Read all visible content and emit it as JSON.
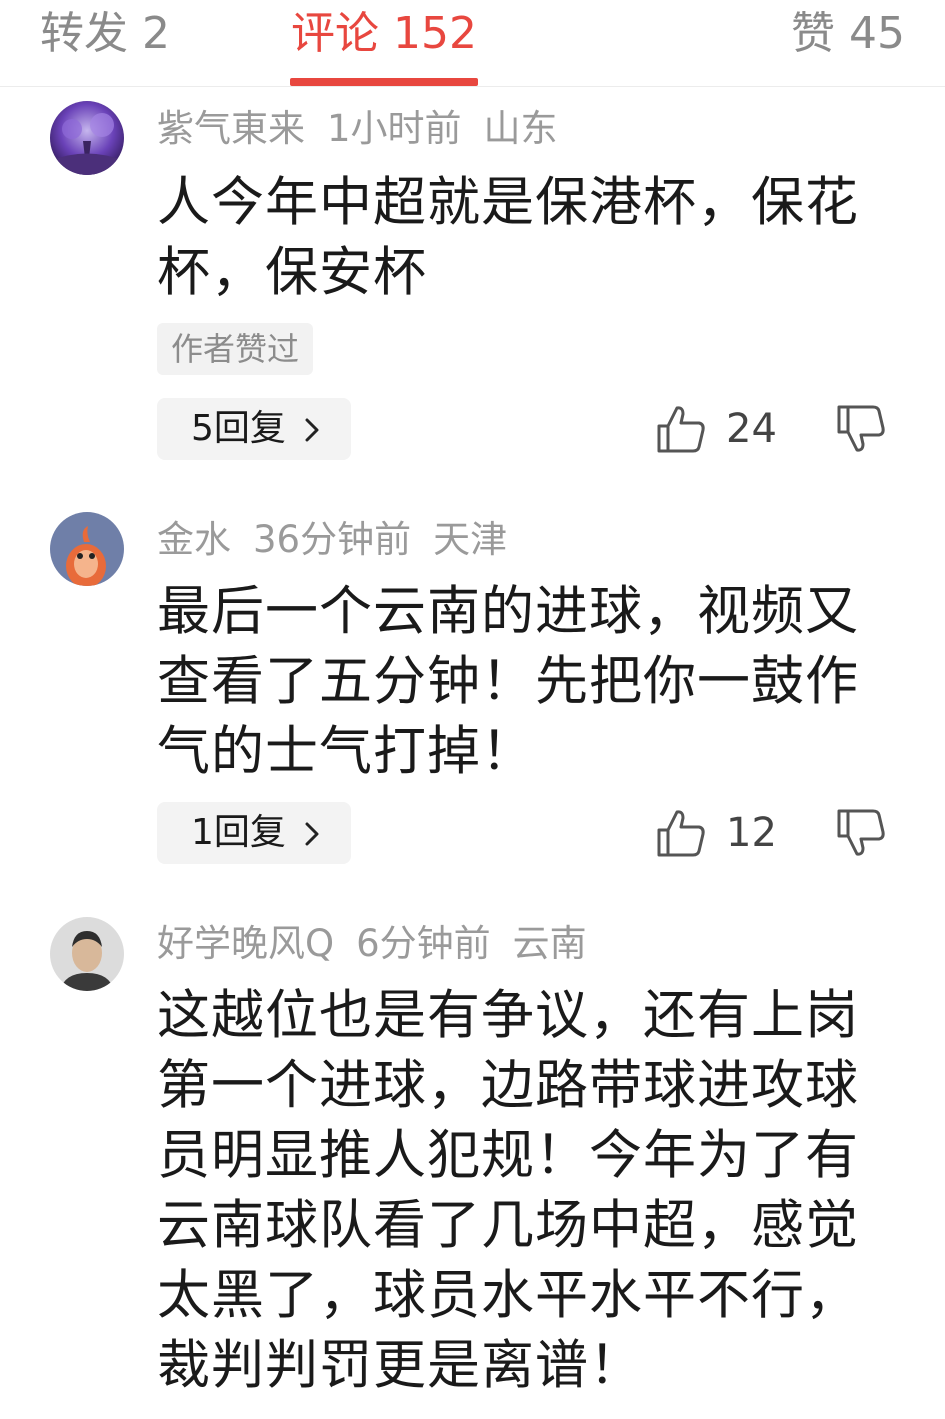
{
  "tabs": {
    "repost": "转发 2",
    "comments": "评论 152",
    "likes": "赞 45"
  },
  "comments": [
    {
      "user": "紫气東来",
      "time": "1小时前",
      "location": "山东",
      "text": "人今年中超就是保港杯，保花杯，保安杯",
      "tag": "作者赞过",
      "replies": "5回复",
      "like_count": "24"
    },
    {
      "user": "金水",
      "time": "36分钟前",
      "location": "天津",
      "text": "最后一个云南的进球，视频又查看了五分钟！先把你一鼓作气的士气打掉！",
      "replies": "1回复",
      "like_count": "12"
    },
    {
      "user": "好学晚风Q",
      "time": "6分钟前",
      "location": "云南",
      "text": "这越位也是有争议，还有上岗第一个进球，边路带球进攻球员明显推人犯规！今年为了有云南球队看了几场中超，感觉太黑了，球员水平水平不行，裁判判罚更是离谱！"
    }
  ],
  "icons": {
    "like": "thumbs-up-icon",
    "dislike": "thumbs-down-icon",
    "reply_arrow": "chevron-right-icon"
  },
  "colors": {
    "accent": "#e8473f",
    "meta_text": "#9a9a9a",
    "body_text": "#1a1a1a"
  }
}
